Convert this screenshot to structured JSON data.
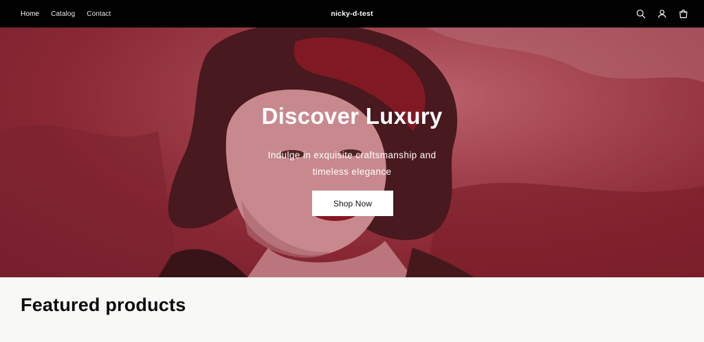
{
  "nav": {
    "items": [
      {
        "label": "Home"
      },
      {
        "label": "Catalog"
      },
      {
        "label": "Contact"
      }
    ]
  },
  "store": {
    "name": "nicky-d-test"
  },
  "header_icons": [
    "search-icon",
    "account-icon",
    "cart-icon"
  ],
  "hero": {
    "title": "Discover Luxury",
    "subtitle": "Indulge in exquisite craftsmanship and timeless elegance",
    "button_label": "Shop Now"
  },
  "featured": {
    "heading": "Featured products"
  },
  "colors": {
    "header_bg": "#020202",
    "hero_tint": "#a94a55",
    "button_bg": "#ffffff",
    "page_bg": "#f8f8f6"
  }
}
